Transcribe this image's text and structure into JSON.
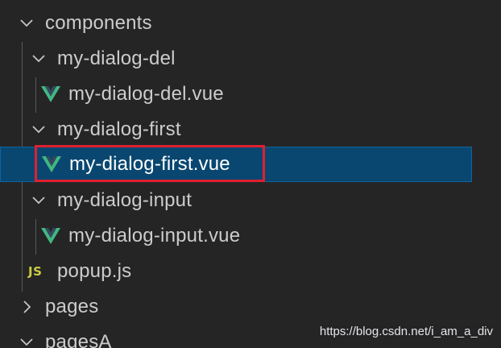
{
  "explorer": {
    "items": [
      {
        "label": "components",
        "type": "folder",
        "expanded": true,
        "icon": "chevron-down-icon"
      },
      {
        "label": "my-dialog-del",
        "type": "folder",
        "expanded": true,
        "icon": "chevron-down-icon"
      },
      {
        "label": "my-dialog-del.vue",
        "type": "file",
        "icon": "vue-file-icon"
      },
      {
        "label": "my-dialog-first",
        "type": "folder",
        "expanded": true,
        "icon": "chevron-down-icon"
      },
      {
        "label": "my-dialog-first.vue",
        "type": "file",
        "icon": "vue-file-icon",
        "selected": true
      },
      {
        "label": "my-dialog-input",
        "type": "folder",
        "expanded": true,
        "icon": "chevron-down-icon"
      },
      {
        "label": "my-dialog-input.vue",
        "type": "file",
        "icon": "vue-file-icon"
      },
      {
        "label": "popup.js",
        "type": "file",
        "icon": "js-file-icon",
        "icon_text": "JS"
      },
      {
        "label": "pages",
        "type": "folder",
        "expanded": false,
        "icon": "chevron-right-icon"
      },
      {
        "label": "pagesA",
        "type": "folder",
        "expanded": true,
        "icon": "chevron-down-icon"
      }
    ]
  },
  "colors": {
    "background": "#252526",
    "selection": "#094771",
    "highlight_box": "#e0202e",
    "vue_green": "#41b883",
    "js_yellow": "#cbcb41"
  },
  "watermark": {
    "text": "https://blog.csdn.net/i_am_a_div"
  }
}
